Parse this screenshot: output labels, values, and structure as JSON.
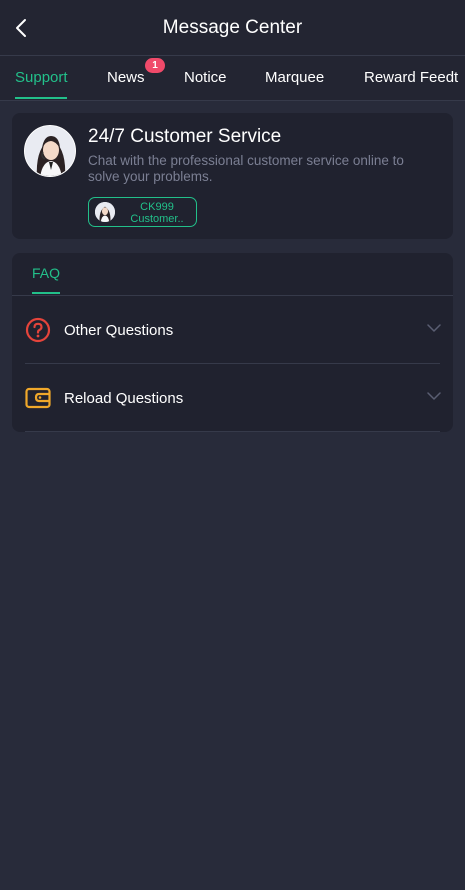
{
  "header": {
    "title": "Message Center"
  },
  "tabs": [
    {
      "label": "Support",
      "active": true
    },
    {
      "label": "News",
      "badge": "1"
    },
    {
      "label": "Notice"
    },
    {
      "label": "Marquee"
    },
    {
      "label": "Reward Feedt"
    }
  ],
  "support": {
    "title": "24/7 Customer Service",
    "description": "Chat with the professional customer service online to solve your problems.",
    "agent": {
      "name_line1": "CK999",
      "name_line2": "Customer.."
    }
  },
  "faq": {
    "tab_label": "FAQ",
    "items": [
      {
        "label": "Other Questions",
        "icon": "question-circle-icon"
      },
      {
        "label": "Reload Questions",
        "icon": "wallet-icon"
      }
    ]
  },
  "colors": {
    "accent": "#22c08a",
    "background": "#282b3a",
    "card": "#20222f",
    "badge": "#f04a6a",
    "question_icon": "#e5443b",
    "wallet_icon": "#f0a82a"
  }
}
